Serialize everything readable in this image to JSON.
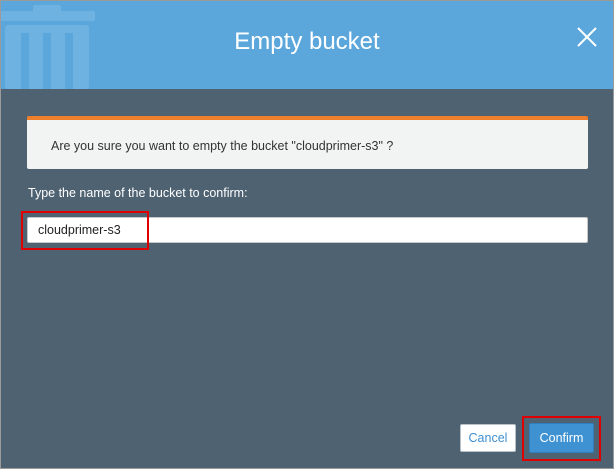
{
  "dialog": {
    "title": "Empty bucket",
    "header_icon": "trash-icon",
    "close_icon": "close-icon",
    "alert_message": "Are you sure you want to empty the bucket \"cloudprimer-s3\" ?",
    "confirm_label": "Type the name of the bucket to confirm:",
    "bucket_name_input": {
      "value": "cloudprimer-s3",
      "placeholder": ""
    },
    "cancel_label": "Cancel",
    "confirm_button_label": "Confirm"
  },
  "colors": {
    "header_bg": "#5ba7dc",
    "body_bg": "#4e6272",
    "alert_accent": "#ee7f2d",
    "primary_button": "#3f92d2",
    "highlight": "#e00000"
  }
}
